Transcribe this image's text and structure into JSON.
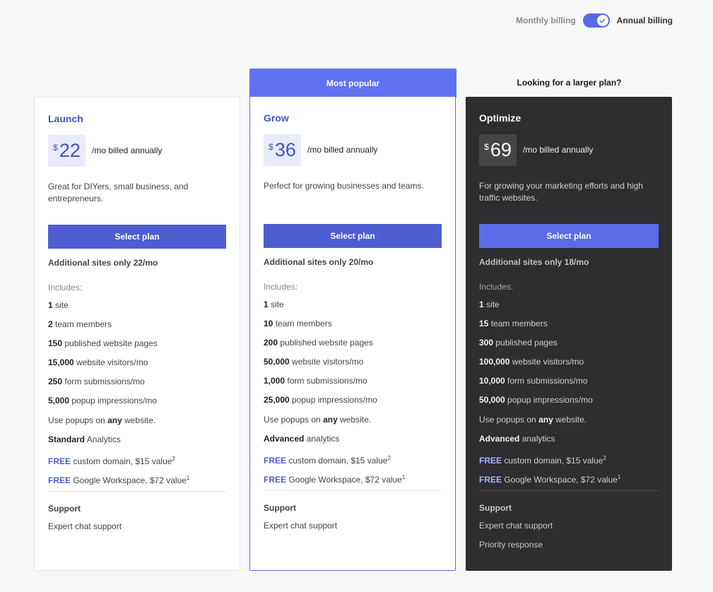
{
  "billing": {
    "monthly_label": "Monthly billing",
    "annual_label": "Annual billing",
    "annual_selected": true
  },
  "banners": {
    "most_popular": "Most popular",
    "larger_plan": "Looking for a larger plan?"
  },
  "colors": {
    "accent": "#5a6be8",
    "button": "#4e5ed1",
    "dark_card": "#2e2d2f"
  },
  "plans": [
    {
      "name": "Launch",
      "currency": "$",
      "price": "22",
      "billed": "/mo billed annually",
      "description": "Great for DIYers, small business, and entrepreneurs.",
      "button": "Select plan",
      "additional": "Additional sites only 22/mo",
      "includes_label": "Includes:",
      "features": [
        {
          "bold": "1",
          "text": " site"
        },
        {
          "bold": "2",
          "text": " team members"
        },
        {
          "bold": "150",
          "text": " published website pages"
        },
        {
          "bold": "15,000",
          "text": " website visitors/mo"
        },
        {
          "bold": "250",
          "text": " form submissions/mo"
        },
        {
          "bold": "5,000",
          "text": " popup impressions/mo"
        },
        {
          "pre": "Use popups on ",
          "bold": "any",
          "text": " website."
        },
        {
          "bold": "Standard",
          "text": " Analytics"
        },
        {
          "free": "FREE",
          "text": " custom domain, $15 value",
          "sup": "2"
        },
        {
          "free": "FREE",
          "text": " Google Workspace, $72 value",
          "sup": "1"
        }
      ],
      "support_label": "Support",
      "support": [
        "Expert chat support"
      ]
    },
    {
      "name": "Grow",
      "currency": "$",
      "price": "36",
      "billed": "/mo billed annually",
      "description": "Perfect for growing businesses and teams.",
      "button": "Select plan",
      "additional": "Additional sites only 20/mo",
      "includes_label": "Includes:",
      "features": [
        {
          "bold": "1",
          "text": " site"
        },
        {
          "bold": "10",
          "text": " team members"
        },
        {
          "bold": "200",
          "text": " published website pages"
        },
        {
          "bold": "50,000",
          "text": " website visitors/mo"
        },
        {
          "bold": "1,000",
          "text": " form submissions/mo"
        },
        {
          "bold": "25,000",
          "text": " popup impressions/mo"
        },
        {
          "pre": "Use popups on ",
          "bold": "any",
          "text": " website."
        },
        {
          "bold": "Advanced",
          "text": " analytics"
        },
        {
          "free": "FREE",
          "text": " custom domain, $15 value",
          "sup": "2"
        },
        {
          "free": "FREE",
          "text": " Google Workspace, $72 value",
          "sup": "1"
        }
      ],
      "support_label": "Support",
      "support": [
        "Expert chat support"
      ]
    },
    {
      "name": "Optimize",
      "currency": "$",
      "price": "69",
      "billed": "/mo billed annually",
      "description": "For growing your marketing efforts and high traffic websites.",
      "button": "Select plan",
      "additional": "Additional sites only 18/mo",
      "includes_label": "Includes:",
      "features": [
        {
          "bold": "1",
          "text": " site"
        },
        {
          "bold": "15",
          "text": " team members"
        },
        {
          "bold": "300",
          "text": " published pages"
        },
        {
          "bold": "100,000",
          "text": " website visitors/mo"
        },
        {
          "bold": "10,000",
          "text": " form submissions/mo"
        },
        {
          "bold": "50,000",
          "text": " popup impressions/mo"
        },
        {
          "pre": "Use popups on ",
          "bold": "any",
          "text": " website."
        },
        {
          "bold": "Advanced",
          "text": " analytics"
        },
        {
          "free": "FREE",
          "text": " custom domain, $15 value",
          "sup": "2"
        },
        {
          "free": "FREE",
          "text": " Google Workspace, $72 value",
          "sup": "1"
        }
      ],
      "support_label": "Support",
      "support": [
        "Expert chat support",
        "Priority response"
      ]
    }
  ]
}
